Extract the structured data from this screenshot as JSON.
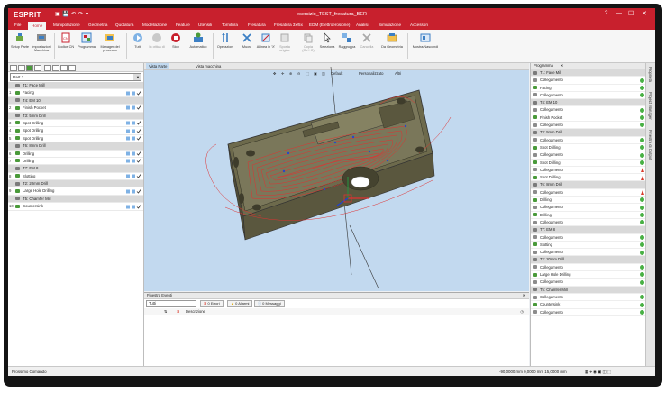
{
  "app": {
    "logo": "ESPRIT",
    "window_title": "esercizio_TEST_fresatura_BER"
  },
  "window_controls": {
    "help": "?",
    "minimize": "—",
    "maximize": "☐",
    "close": "✕"
  },
  "quick_access": [
    "▣",
    "💾",
    "↶",
    "↷",
    "▾"
  ],
  "menu": [
    "File",
    "Home",
    "Manipolazione",
    "Geometria",
    "Quotatura",
    "Modellazione",
    "Feature",
    "Utensili",
    "Tornitura",
    "Fresatura",
    "Fresatura 3x/5x",
    "EDM (Elettroerosione)",
    "Analisi",
    "Simulazione",
    "Accessori"
  ],
  "menu_active_index": 1,
  "ribbon": [
    {
      "label": "Setup Parte",
      "icon": "setup-part-icon",
      "disabled": false
    },
    {
      "label": "Impostazioni Macchina",
      "icon": "machine-settings-icon",
      "disabled": false
    },
    {
      "label": "Codice CN",
      "icon": "nc-code-icon",
      "disabled": false
    },
    {
      "label": "Programma",
      "icon": "program-icon",
      "disabled": false
    },
    {
      "label": "Manager del processo",
      "icon": "process-manager-icon",
      "disabled": false
    },
    {
      "label": "Tutti",
      "icon": "simulate-all-icon",
      "disabled": false
    },
    {
      "label": "In ottica di",
      "icon": "in-view-icon",
      "disabled": true
    },
    {
      "label": "Stop",
      "icon": "stop-icon",
      "disabled": false
    },
    {
      "label": "Automatico",
      "icon": "automatic-icon",
      "disabled": false
    },
    {
      "label": "Operazioni",
      "icon": "operations-icon",
      "disabled": false
    },
    {
      "label": "Muovi",
      "icon": "move-icon",
      "disabled": false
    },
    {
      "label": "Allinea in 'X'",
      "icon": "align-x-icon",
      "disabled": false
    },
    {
      "label": "Sposta origine",
      "icon": "move-origin-icon",
      "disabled": true
    },
    {
      "label": "Copia (Ctrl+C)",
      "icon": "copy-icon",
      "disabled": true
    },
    {
      "label": "Seleziona",
      "icon": "select-icon",
      "disabled": false
    },
    {
      "label": "Raggruppa",
      "icon": "group-icon",
      "disabled": false
    },
    {
      "label": "Cancella",
      "icon": "delete-icon",
      "disabled": true
    },
    {
      "label": "Da Geometria",
      "icon": "from-geometry-icon",
      "disabled": false
    },
    {
      "label": "Mostra/Nascondi",
      "icon": "show-hide-icon",
      "disabled": false
    }
  ],
  "part_select": "Part 1",
  "operations": [
    {
      "num": "",
      "label": "T1: Face Mill",
      "tool": true
    },
    {
      "num": "1",
      "label": "Facing",
      "tool": false
    },
    {
      "num": "",
      "label": "T4: EM 10",
      "tool": true
    },
    {
      "num": "2",
      "label": "Finish Pocket",
      "tool": false
    },
    {
      "num": "",
      "label": "T3: 5mm Drill",
      "tool": true
    },
    {
      "num": "3",
      "label": "Spot Drilling",
      "tool": false
    },
    {
      "num": "4",
      "label": "Spot Drilling",
      "tool": false
    },
    {
      "num": "5",
      "label": "Spot Drilling",
      "tool": false
    },
    {
      "num": "",
      "label": "T6: 8mm Drill",
      "tool": true
    },
    {
      "num": "6",
      "label": "Drilling",
      "tool": false
    },
    {
      "num": "7",
      "label": "Drilling",
      "tool": false
    },
    {
      "num": "",
      "label": "T7: EM 8",
      "tool": true
    },
    {
      "num": "8",
      "label": "Slotting",
      "tool": false
    },
    {
      "num": "",
      "label": "T2: 20mm Drill",
      "tool": true
    },
    {
      "num": "9",
      "label": "Large Hole Drilling",
      "tool": false
    },
    {
      "num": "",
      "label": "T5: Chamfer Mill",
      "tool": true
    },
    {
      "num": "10",
      "label": "Countersink",
      "tool": false
    }
  ],
  "viewport": {
    "tabs": [
      "Vista Parte",
      "Vista macchina"
    ],
    "active_tab": 0,
    "toolbar": {
      "default": "Default",
      "custom": "Personalizzato",
      "more": "Altri"
    }
  },
  "events": {
    "title": "Finestra Eventi",
    "filter": "Tutti",
    "errors": "0 Errori",
    "warnings": "0 Allarmi",
    "messages": "0 Messaggi",
    "col_description": "Descrizione"
  },
  "programs": {
    "title": "Programma",
    "rows": [
      {
        "label": "T1: Face Mill",
        "type": "tool",
        "status": ""
      },
      {
        "label": "Collegamento",
        "type": "link",
        "status": "ok"
      },
      {
        "label": "Facing",
        "type": "op",
        "status": "ok"
      },
      {
        "label": "Collegamento",
        "type": "link",
        "status": "ok"
      },
      {
        "label": "T4: EM 10",
        "type": "tool",
        "status": ""
      },
      {
        "label": "Collegamento",
        "type": "link",
        "status": "ok"
      },
      {
        "label": "Finish Pocket",
        "type": "op",
        "status": "ok"
      },
      {
        "label": "Collegamento",
        "type": "link",
        "status": "ok"
      },
      {
        "label": "T3: 5mm Drill",
        "type": "tool",
        "status": ""
      },
      {
        "label": "Collegamento",
        "type": "link",
        "status": "ok"
      },
      {
        "label": "Spot Drilling",
        "type": "op",
        "status": "ok"
      },
      {
        "label": "Collegamento",
        "type": "link",
        "status": "ok"
      },
      {
        "label": "Spot Drilling",
        "type": "op",
        "status": "ok"
      },
      {
        "label": "Collegamento",
        "type": "link",
        "status": "warn"
      },
      {
        "label": "Spot Drilling",
        "type": "op",
        "status": "warn"
      },
      {
        "label": "T6: 8mm Drill",
        "type": "tool",
        "status": ""
      },
      {
        "label": "Collegamento",
        "type": "link",
        "status": "warn"
      },
      {
        "label": "Drilling",
        "type": "op",
        "status": "ok"
      },
      {
        "label": "Collegamento",
        "type": "link",
        "status": "ok"
      },
      {
        "label": "Drilling",
        "type": "op",
        "status": "ok"
      },
      {
        "label": "Collegamento",
        "type": "link",
        "status": "ok"
      },
      {
        "label": "T7: EM 8",
        "type": "tool",
        "status": ""
      },
      {
        "label": "Collegamento",
        "type": "link",
        "status": "ok"
      },
      {
        "label": "Slotting",
        "type": "op",
        "status": "ok"
      },
      {
        "label": "Collegamento",
        "type": "link",
        "status": "ok"
      },
      {
        "label": "T2: 20mm Drill",
        "type": "tool",
        "status": ""
      },
      {
        "label": "Collegamento",
        "type": "link",
        "status": "ok"
      },
      {
        "label": "Large Hole Drilling",
        "type": "op",
        "status": "ok"
      },
      {
        "label": "Collegamento",
        "type": "link",
        "status": "ok"
      },
      {
        "label": "T5: Chamfer Mill",
        "type": "tool",
        "status": ""
      },
      {
        "label": "Collegamento",
        "type": "link",
        "status": "ok"
      },
      {
        "label": "Countersink",
        "type": "op",
        "status": "ok"
      },
      {
        "label": "Collegamento",
        "type": "link",
        "status": "ok"
      }
    ]
  },
  "side_tabs": [
    "Proprietà",
    "Project Manager",
    "Finestra di Output"
  ],
  "status": {
    "left": "Prossimo Comando",
    "coords": "-90,0000 mm  0,0000 mm  15,0000 mm"
  },
  "colors": {
    "brand_red": "#c8202d",
    "viewport_bg": "#c2d9ef",
    "part": "#6d6a4c",
    "toolpath": "#e03131",
    "ok": "#48b044",
    "warn": "#d93a2b"
  }
}
